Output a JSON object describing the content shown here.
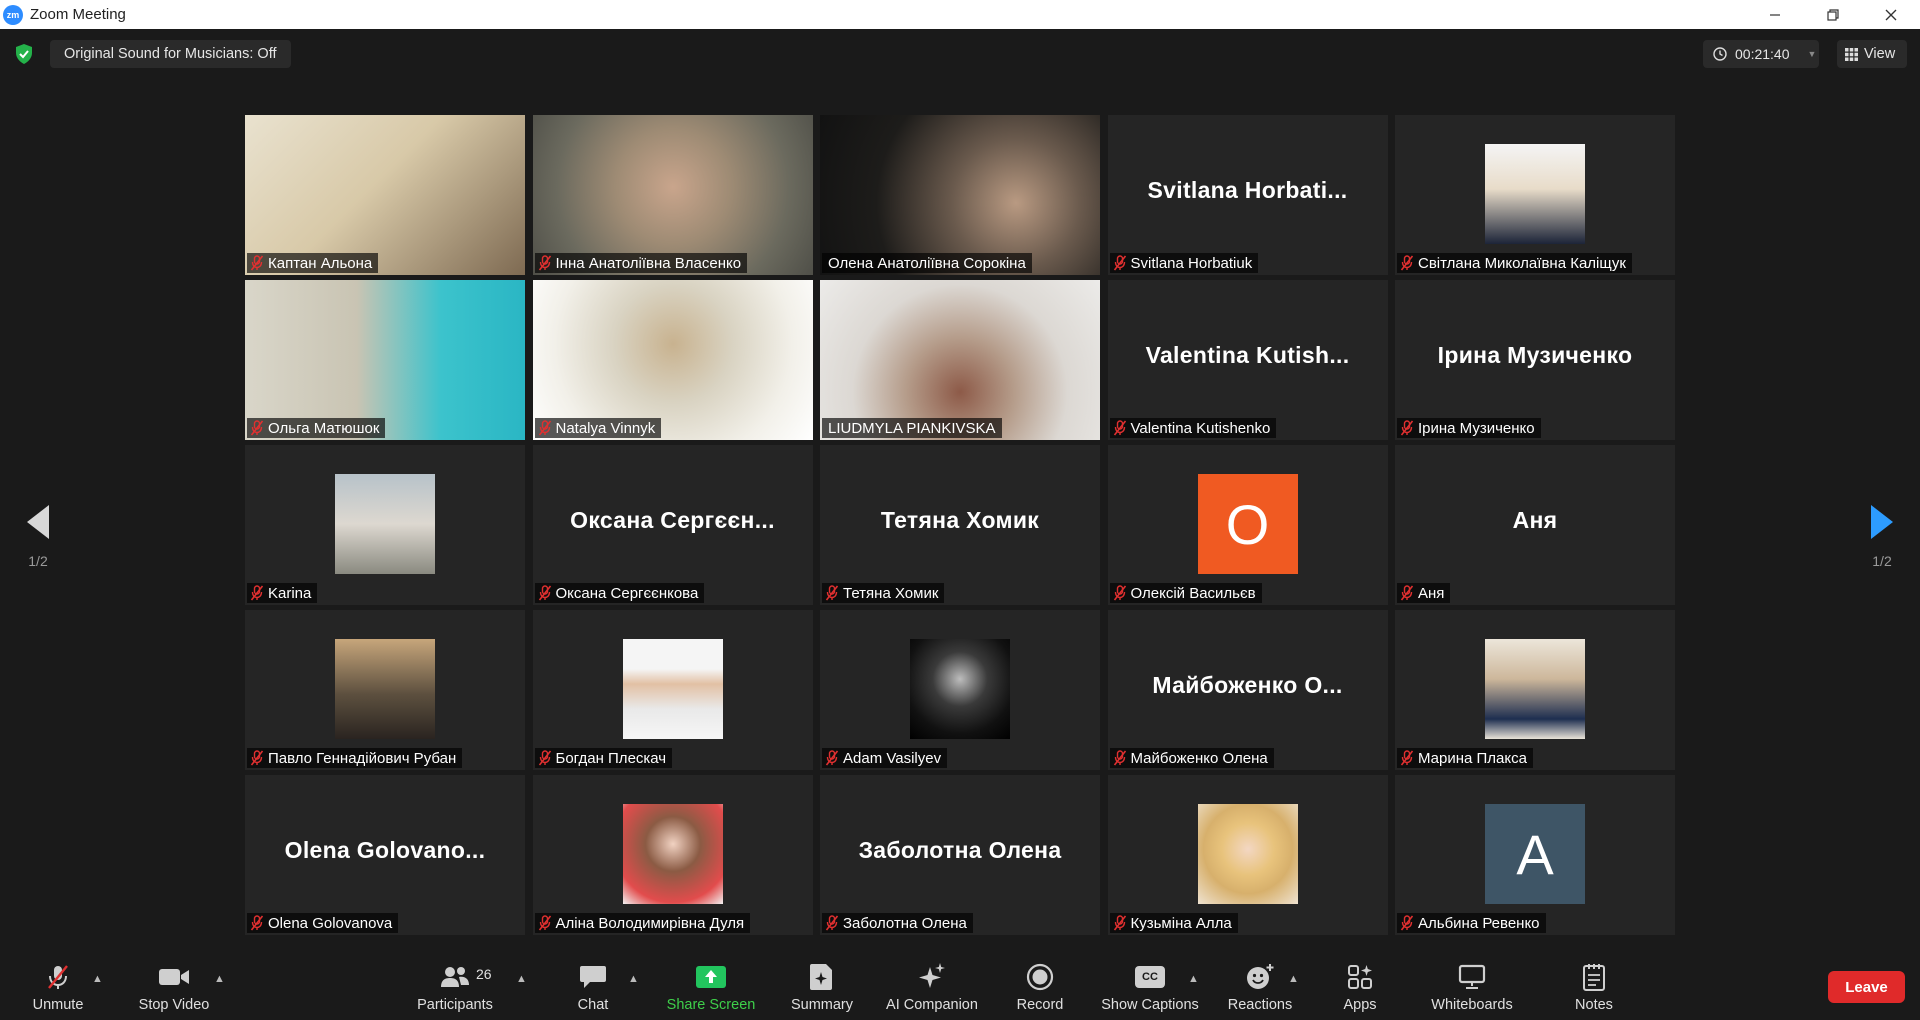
{
  "window": {
    "title": "Zoom Meeting",
    "logo_text": "zm"
  },
  "topbar": {
    "sound_status": "Original Sound for Musicians: Off",
    "timer": "00:21:40",
    "view_label": "View"
  },
  "pagination": {
    "left": "1/2",
    "right": "1/2"
  },
  "colors": {
    "active_speaker": "#c9f16b",
    "share_green": "#3ecf4a",
    "leave_red": "#e02a2a",
    "avatar_orange": "#f05a22",
    "avatar_slate": "#3e5566"
  },
  "tiles": [
    {
      "name": "Каптан Альона",
      "type": "video",
      "muted": true
    },
    {
      "name": "Інна Анатоліївна Власенко",
      "type": "video",
      "muted": true
    },
    {
      "name": "Олена Анатоліївна Сорокіна",
      "type": "video",
      "muted": false,
      "active": true
    },
    {
      "name": "Svitlana Horbatiuk",
      "type": "name",
      "center_text": "Svitlana  Horbati...",
      "muted": true
    },
    {
      "name": "Світлана Миколаївна Каліщук",
      "type": "photo",
      "muted": true
    },
    {
      "name": "Ольга Матюшок",
      "type": "video",
      "muted": true
    },
    {
      "name": "Natalya Vinnyk",
      "type": "video",
      "muted": true
    },
    {
      "name": "LIUDMYLA  PIANKIVSKA",
      "type": "video",
      "muted": false
    },
    {
      "name": "Valentina Kutishenko",
      "type": "name",
      "center_text": "Valentina  Kutish...",
      "muted": true
    },
    {
      "name": "Ірина Музиченко",
      "type": "name",
      "center_text": "Ірина  Музиченко",
      "muted": true
    },
    {
      "name": "Karina",
      "type": "photo",
      "muted": true
    },
    {
      "name": "Оксана Сергєєнкова",
      "type": "name",
      "center_text": "Оксана  Сергєєн...",
      "muted": true
    },
    {
      "name": "Тетяна Хомик",
      "type": "name",
      "center_text": "Тетяна Хомик",
      "muted": true
    },
    {
      "name": "Олексій Васильєв",
      "type": "letter",
      "letter": "O",
      "muted": true
    },
    {
      "name": "Аня",
      "type": "name",
      "center_text": "Аня",
      "muted": true
    },
    {
      "name": "Павло Геннадійович Рубан",
      "type": "photo",
      "muted": true
    },
    {
      "name": "Богдан Плескач",
      "type": "photo",
      "muted": true
    },
    {
      "name": "Adam Vasilyev",
      "type": "photo",
      "muted": true
    },
    {
      "name": "Майбоженко Олена",
      "type": "name",
      "center_text": "Майбоженко  О...",
      "muted": true
    },
    {
      "name": "Марина Плакса",
      "type": "photo",
      "muted": true
    },
    {
      "name": "Olena Golovanova",
      "type": "name",
      "center_text": "Olena  Golovano...",
      "muted": true
    },
    {
      "name": "Аліна Володимирівна Дуля",
      "type": "photo",
      "muted": true
    },
    {
      "name": "Заболотна Олена",
      "type": "name",
      "center_text": "Заболотна Олена",
      "muted": true
    },
    {
      "name": "Кузьміна Алла",
      "type": "photo",
      "muted": true
    },
    {
      "name": "Альбина Ревенко",
      "type": "letter",
      "letter": "A",
      "muted": true
    }
  ],
  "toolbar": {
    "unmute": "Unmute",
    "stop_video": "Stop Video",
    "participants": "Participants",
    "participants_count": "26",
    "chat": "Chat",
    "share_screen": "Share Screen",
    "summary": "Summary",
    "ai_companion": "AI Companion",
    "record": "Record",
    "show_captions": "Show Captions",
    "captions_badge": "CC",
    "reactions": "Reactions",
    "apps": "Apps",
    "whiteboards": "Whiteboards",
    "notes": "Notes",
    "leave": "Leave"
  }
}
